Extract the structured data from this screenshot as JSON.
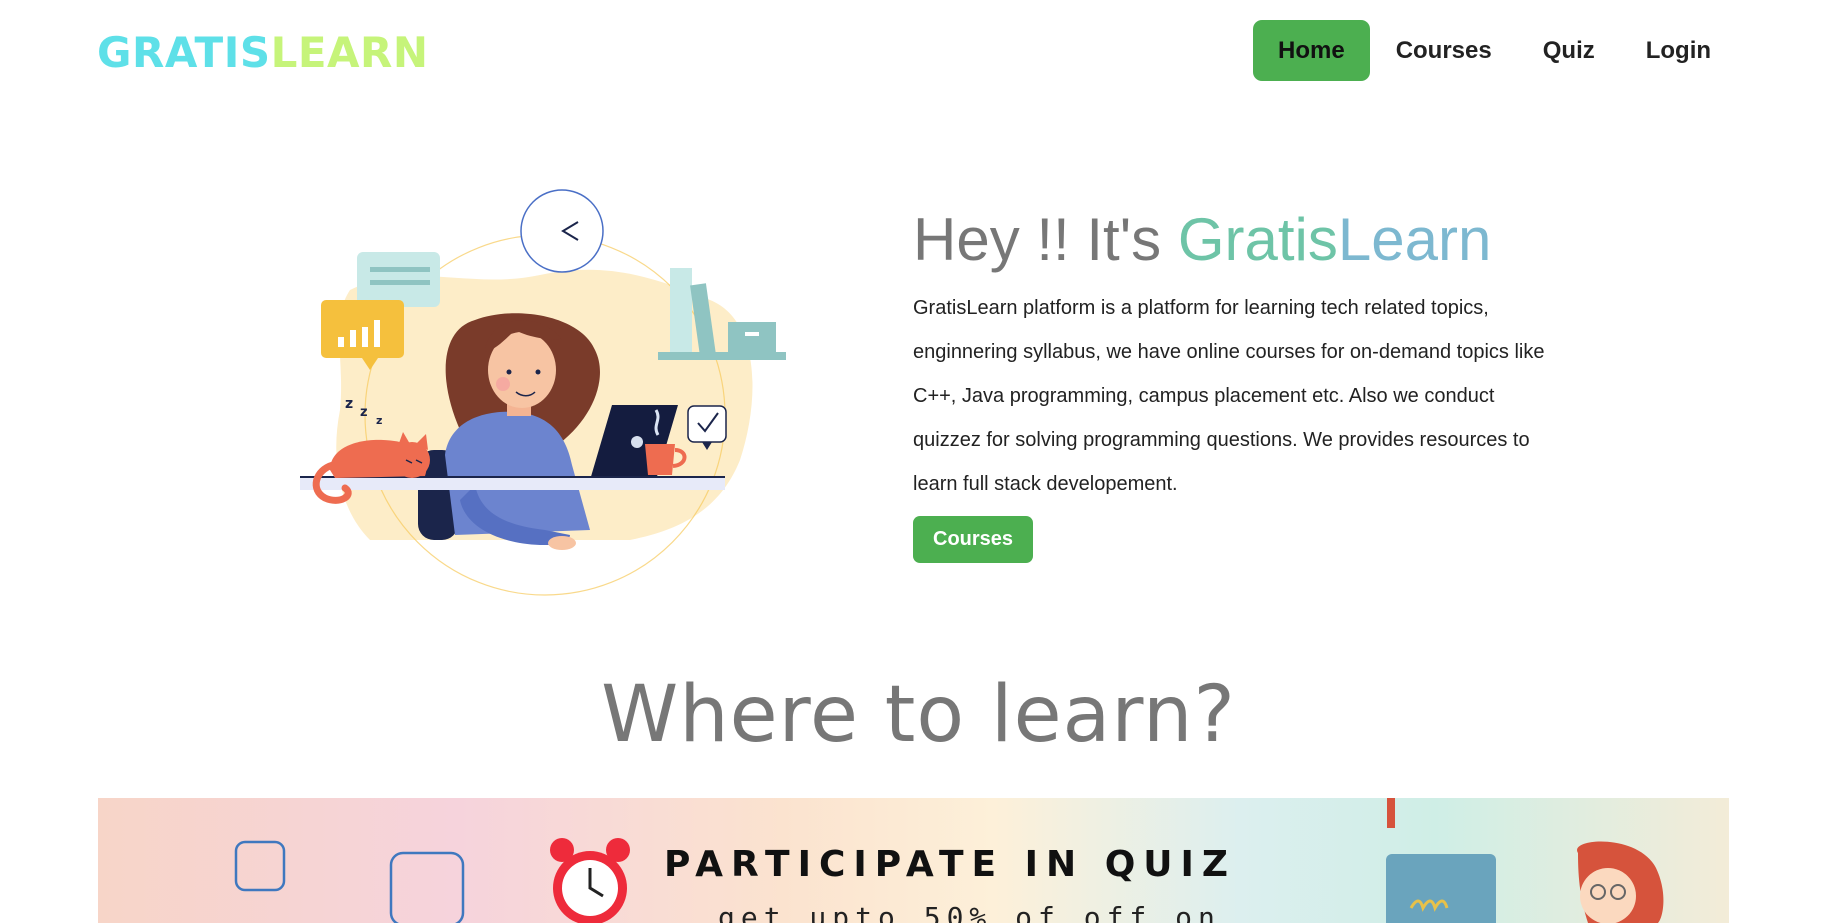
{
  "nav": {
    "logo_part1": "GRATIS",
    "logo_part2": "LEARN",
    "items": [
      {
        "label": "Home",
        "active": true
      },
      {
        "label": "Courses",
        "active": false
      },
      {
        "label": "Quiz",
        "active": false
      },
      {
        "label": "Login",
        "active": false
      }
    ]
  },
  "hero": {
    "title_prefix": "Hey !! It's ",
    "title_brand1": "Gratis",
    "title_brand2": "Learn",
    "description": "GratisLearn platform is a platform for learning tech related topics, enginnering syllabus, we have online courses for on-demand topics like C++, Java programming, campus placement etc. Also we conduct quizzez for solving programming questions. We provides resources to learn full stack developement.",
    "button_label": "Courses"
  },
  "section": {
    "title": "Where to learn?"
  },
  "banner": {
    "title": "PARTICIPATE IN QUIZ",
    "subtitle": "get upto 50% of off on"
  },
  "colors": {
    "accent_green": "#4caf50",
    "logo_cyan": "#5ee0e8",
    "logo_lime": "#c6f47a",
    "brand_teal": "#6ec4a7",
    "brand_blue": "#7db8d0"
  }
}
